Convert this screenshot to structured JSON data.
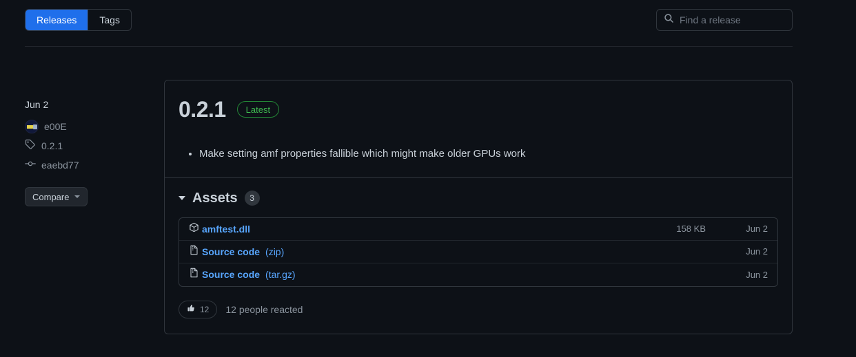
{
  "header": {
    "tabs": [
      {
        "label": "Releases",
        "active": true
      },
      {
        "label": "Tags",
        "active": false
      }
    ],
    "search": {
      "placeholder": "Find a release",
      "icon": "search-icon"
    }
  },
  "sidebar": {
    "date": "Jun 2",
    "author": {
      "name": "e00E",
      "avatar": "user-avatar"
    },
    "tag": {
      "icon": "tag-icon",
      "label": "0.2.1"
    },
    "commit": {
      "icon": "commit-icon",
      "label": "eaebd77"
    },
    "compare_button": {
      "label": "Compare",
      "icon": "chevron-down-icon"
    }
  },
  "release": {
    "version": "0.2.1",
    "badge": "Latest",
    "notes": [
      "Make setting amf properties fallible which might make older GPUs work"
    ]
  },
  "assets": {
    "title": "Assets",
    "count": "3",
    "items": [
      {
        "icon": "package-icon",
        "name": "amftest.dll",
        "ext": "",
        "size": "158 KB",
        "date": "Jun 2"
      },
      {
        "icon": "file-zip-icon",
        "name": "Source code",
        "ext": "(zip)",
        "size": "",
        "date": "Jun 2"
      },
      {
        "icon": "file-zip-icon",
        "name": "Source code",
        "ext": "(tar.gz)",
        "size": "",
        "date": "Jun 2"
      }
    ]
  },
  "reactions": {
    "icon": "thumbs-up-icon",
    "count": "12",
    "summary": "12 people reacted"
  },
  "colors": {
    "page_bg": "#0d1117",
    "border": "#30363d",
    "accent_blue": "#1f6feb",
    "link_blue": "#58a6ff",
    "green": "#3fb950",
    "muted": "#8b949e"
  }
}
